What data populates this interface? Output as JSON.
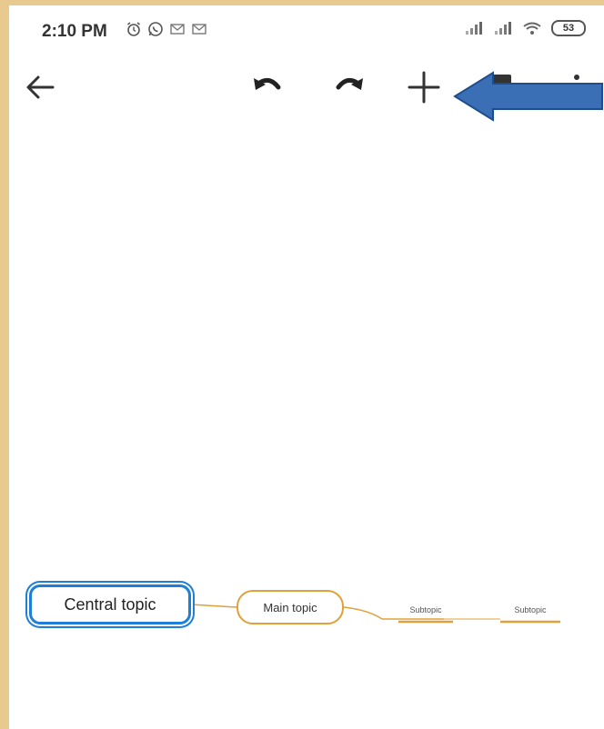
{
  "status_bar": {
    "time": "2:10 PM",
    "battery": "53",
    "icons": [
      "alarm-icon",
      "whatsapp-icon",
      "gmail-icon",
      "gmail-icon",
      "signal-icon",
      "signal-icon",
      "wifi-icon",
      "battery-icon"
    ]
  },
  "toolbar": {
    "icons": [
      "back-arrow-icon",
      "undo-icon",
      "redo-icon",
      "add-icon",
      "copy-icon",
      "more-icon"
    ]
  },
  "annotation": {
    "color": "#3a6fb5",
    "points_to": "add-icon"
  },
  "mindmap": {
    "central_topic": "Central topic",
    "main_topic": "Main topic",
    "subtopics": [
      "Subtopic",
      "Subtopic"
    ],
    "colors": {
      "central_border": "#1e7fd9",
      "branch": "#e0a03a",
      "frame": "#e8c98e"
    }
  }
}
